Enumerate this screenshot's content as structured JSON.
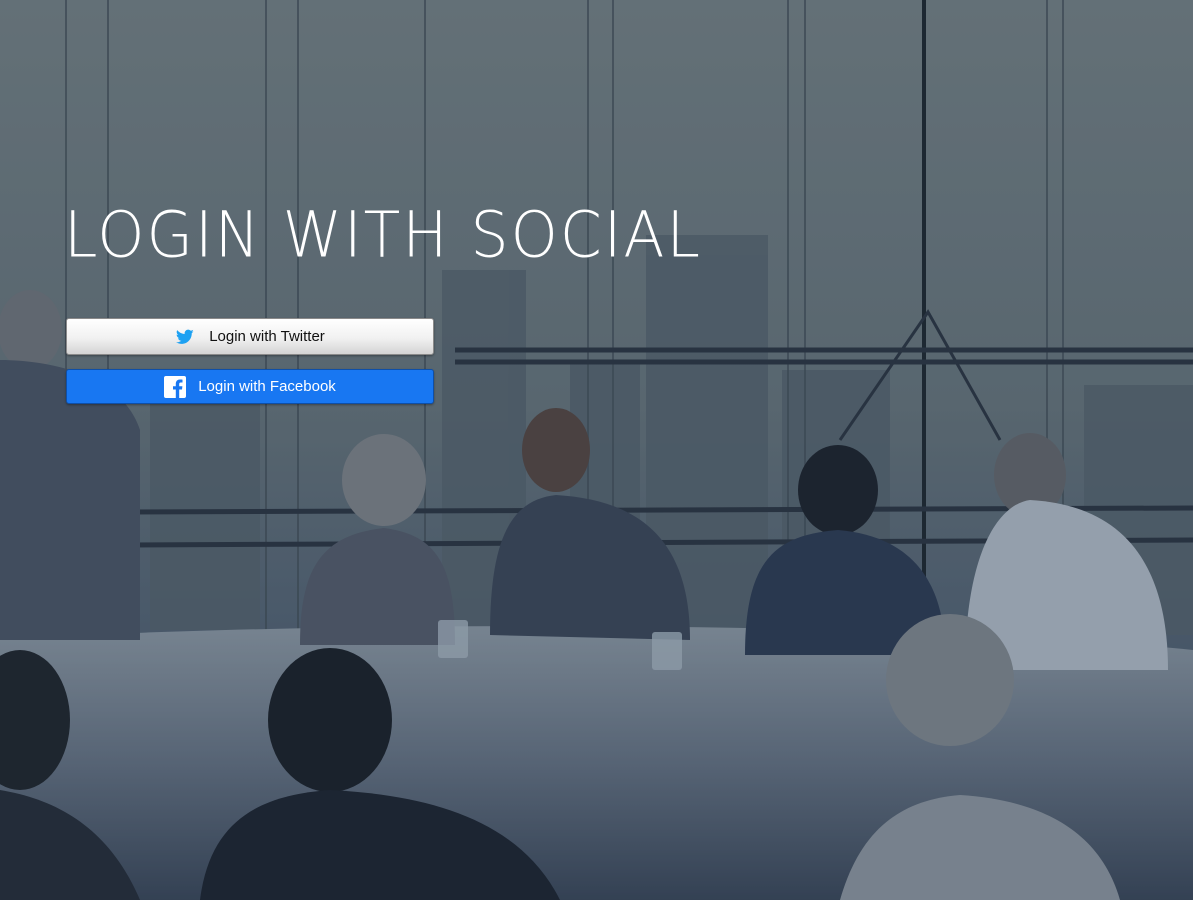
{
  "page": {
    "heading": "LOGIN WITH SOCIAL"
  },
  "buttons": {
    "twitter": {
      "label": "Login with Twitter",
      "icon": "twitter-bird-icon",
      "color": "#1da1f2"
    },
    "facebook": {
      "label": "Login with Facebook",
      "icon": "facebook-f-icon",
      "color": "#1877f2"
    }
  }
}
